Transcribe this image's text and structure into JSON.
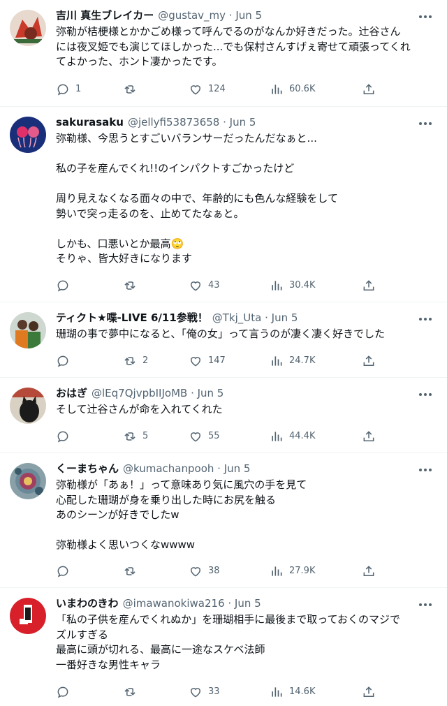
{
  "tweets": [
    {
      "name": "吉川 真生ブレイカー",
      "handle": "@gustav_my · Jun 5",
      "text": "弥勒が桔梗様とかかごめ様って呼んでるのがなんか好きだった。辻谷さん\nには夜叉姫でも演じてほしかった...でも保村さんすげぇ寄せて頑張ってくれ\nてよかった、ホント凄かったです。",
      "replies": "1",
      "retweets": "",
      "likes": "124",
      "views": "60.6K",
      "avatar_colors": [
        "#c93a2a",
        "#7a2b1f"
      ]
    },
    {
      "name": "sakurasaku",
      "handle": "@jellyfi53873658 · Jun 5",
      "text": "弥勒様、今思うとすごいバランサーだったんだなぁと...\n\n私の子を産んでくれ!!のインパクトすごかったけど\n\n周り見えなくなる面々の中で、年齢的にも色んな経験をして\n勢いで突っ走るのを、止めてたなぁと。\n\nしかも、口悪いとか最高🙄\nそりゃ、皆大好きになります",
      "replies": "",
      "retweets": "",
      "likes": "43",
      "views": "30.4K",
      "avatar_colors": [
        "#1a2f7a",
        "#e0306a"
      ]
    },
    {
      "name": "ティクト★喋-LIVE 6/11参戦！",
      "handle": "@Tkj_Uta · Jun 5",
      "text": "珊瑚の事で夢中になると、「俺の女」って言うのが凄く凄く好きでした",
      "replies": "",
      "retweets": "2",
      "likes": "147",
      "views": "24.7K",
      "avatar_colors": [
        "#e07a20",
        "#3b7a3a"
      ]
    },
    {
      "name": "おはぎ",
      "handle": "@lEq7QjvpbIIJoMB · Jun 5",
      "text": "そして辻谷さんが命を入れてくれた",
      "replies": "",
      "retweets": "5",
      "likes": "55",
      "views": "44.4K",
      "avatar_colors": [
        "#d9d2c4",
        "#1b1b1b"
      ]
    },
    {
      "name": "くーまちゃん",
      "handle": "@kumachanpooh · Jun 5",
      "text": "弥勒様が「あぁ！」って意味あり気に風穴の手を見て\n心配した珊瑚が身を乗り出した時にお尻を触る\nあのシーンが好きでしたw\n\n弥勒様よく思いつくなwwww",
      "replies": "",
      "retweets": "",
      "likes": "38",
      "views": "27.9K",
      "avatar_colors": [
        "#6a8a9a",
        "#a04060"
      ]
    },
    {
      "name": "いまわのきわ",
      "handle": "@imawanokiwa216 · Jun 5",
      "text": "「私の子供を産んでくれぬか」を珊瑚相手に最後まで取っておくのマジで\nズルすぎる\n最高に頭が切れる、最高に一途なスケベ法師\n一番好きな男性キャラ",
      "replies": "",
      "retweets": "",
      "likes": "33",
      "views": "14.6K",
      "avatar_colors": [
        "#d8202a",
        "#ffffff"
      ]
    }
  ]
}
